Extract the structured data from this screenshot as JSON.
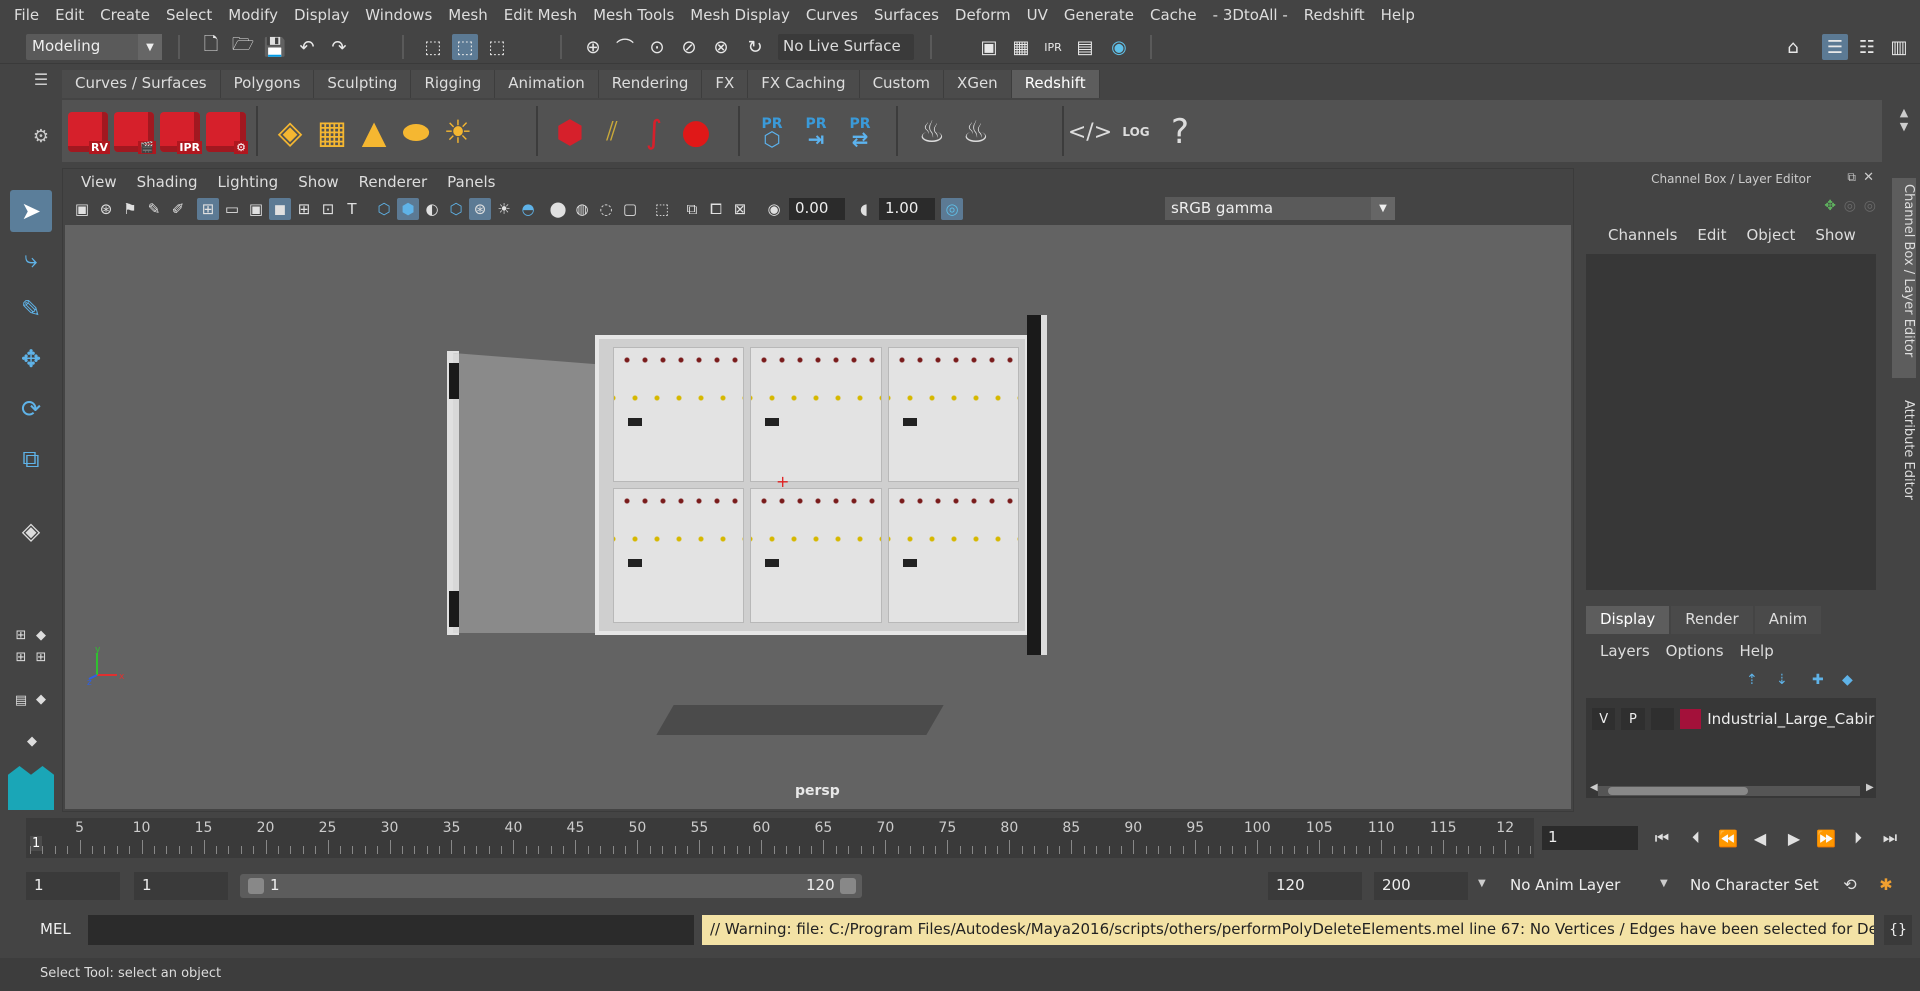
{
  "menubar": {
    "items": [
      "File",
      "Edit",
      "Create",
      "Select",
      "Modify",
      "Display",
      "Windows",
      "Mesh",
      "Edit Mesh",
      "Mesh Tools",
      "Mesh Display",
      "Curves",
      "Surfaces",
      "Deform",
      "UV",
      "Generate",
      "Cache",
      "- 3DtoAll -",
      "Redshift",
      "Help"
    ]
  },
  "statusline": {
    "mode": "Modeling",
    "live_surface": "No Live Surface"
  },
  "shelf": {
    "tabs": [
      "Curves / Surfaces",
      "Polygons",
      "Sculpting",
      "Rigging",
      "Animation",
      "Rendering",
      "FX",
      "FX Caching",
      "Custom",
      "XGen",
      "Redshift"
    ],
    "active_tab": "Redshift",
    "rs_labels": [
      "RV",
      "",
      "IPR",
      ""
    ],
    "pr_labels": [
      "PR",
      "PR",
      "PR"
    ],
    "log_label": "LOG",
    "help_icon": "?"
  },
  "panel": {
    "menus": [
      "View",
      "Shading",
      "Lighting",
      "Show",
      "Renderer",
      "Panels"
    ],
    "exposure": "0.00",
    "gamma_value": "1.00",
    "color_space": "sRGB gamma",
    "camera_label": "persp"
  },
  "channelbox": {
    "title": "Channel Box / Layer Editor",
    "menus": [
      "Channels",
      "Edit",
      "Object",
      "Show"
    ],
    "layer_tabs": [
      "Display",
      "Render",
      "Anim"
    ],
    "layer_menus": [
      "Layers",
      "Options",
      "Help"
    ],
    "layer": {
      "v": "V",
      "p": "P",
      "name": "Industrial_Large_Cabir",
      "color": "#a3113a"
    },
    "side_tabs": [
      "Channel Box / Layer Editor",
      "Attribute Editor"
    ]
  },
  "timeslider": {
    "ticks": [
      "5",
      "10",
      "15",
      "20",
      "25",
      "30",
      "35",
      "40",
      "45",
      "50",
      "55",
      "60",
      "65",
      "70",
      "75",
      "80",
      "85",
      "90",
      "95",
      "100",
      "105",
      "110",
      "115",
      "12"
    ],
    "current_frame_marker": "1",
    "current_frame": "1"
  },
  "rangeslider": {
    "start": "1",
    "playback_start": "1",
    "range_start": "1",
    "range_end": "120",
    "playback_end": "120",
    "end": "200",
    "anim_layer": "No Anim Layer",
    "character_set": "No Character Set"
  },
  "cmdline": {
    "label": "MEL",
    "result": "// Warning: file: C:/Program Files/Autodesk/Maya2016/scripts/others/performPolyDeleteElements.mel line 67: No Vertices / Edges have been selected for Delete!"
  },
  "helpline": {
    "text": "Select Tool: select an object"
  },
  "axis": {
    "x": "x",
    "y": "y",
    "z": "z"
  }
}
